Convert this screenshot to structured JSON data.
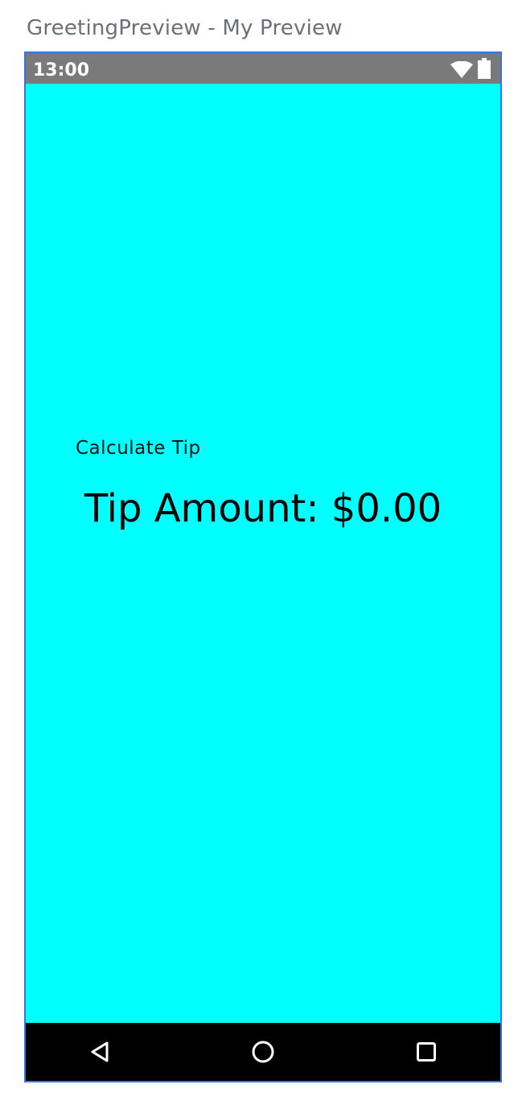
{
  "preview": {
    "title": "GreetingPreview - My Preview"
  },
  "status_bar": {
    "time": "13:00",
    "icons": [
      "wifi-icon",
      "battery-icon"
    ]
  },
  "main": {
    "calculate_label": "Calculate Tip",
    "tip_amount": "Tip Amount: $0.00"
  },
  "nav_bar": {
    "icons": [
      "back-icon",
      "home-icon",
      "recents-icon"
    ]
  },
  "colors": {
    "background": "#00ffff",
    "status_bar": "#7a7a7a",
    "nav_bar": "#000000",
    "frame_border": "#3b73e6"
  }
}
